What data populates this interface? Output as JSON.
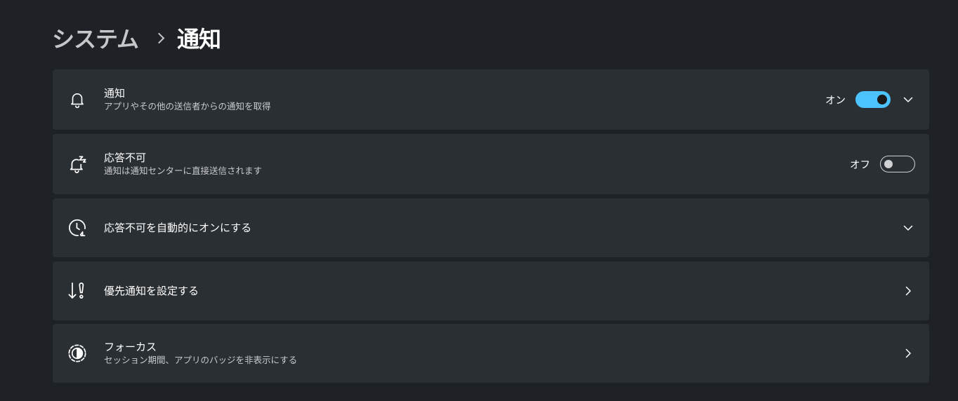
{
  "breadcrumb": {
    "parent": "システム",
    "current": "通知"
  },
  "settings": [
    {
      "title": "通知",
      "subtitle": "アプリやその他の送信者からの通知を取得",
      "icon": "bell-icon",
      "toggle_label": "オン",
      "toggle_state": "on",
      "chevron": "chevron-down-icon"
    },
    {
      "title": "応答不可",
      "subtitle": "通知は通知センターに直接送信されます",
      "icon": "bell-zzz-icon",
      "toggle_label": "オフ",
      "toggle_state": "off"
    },
    {
      "title": "応答不可を自動的にオンにする",
      "icon": "clock-icon",
      "chevron": "chevron-down-icon"
    },
    {
      "title": "優先通知を設定する",
      "icon": "priority-icon",
      "chevron": "chevron-right-icon"
    },
    {
      "title": "フォーカス",
      "subtitle": "セッション期間、アプリのバッジを非表示にする",
      "icon": "focus-icon",
      "chevron": "chevron-right-icon"
    }
  ],
  "colors": {
    "accent": "#4cc2ff",
    "background": "#1e2226",
    "card": "#2a2f33"
  }
}
